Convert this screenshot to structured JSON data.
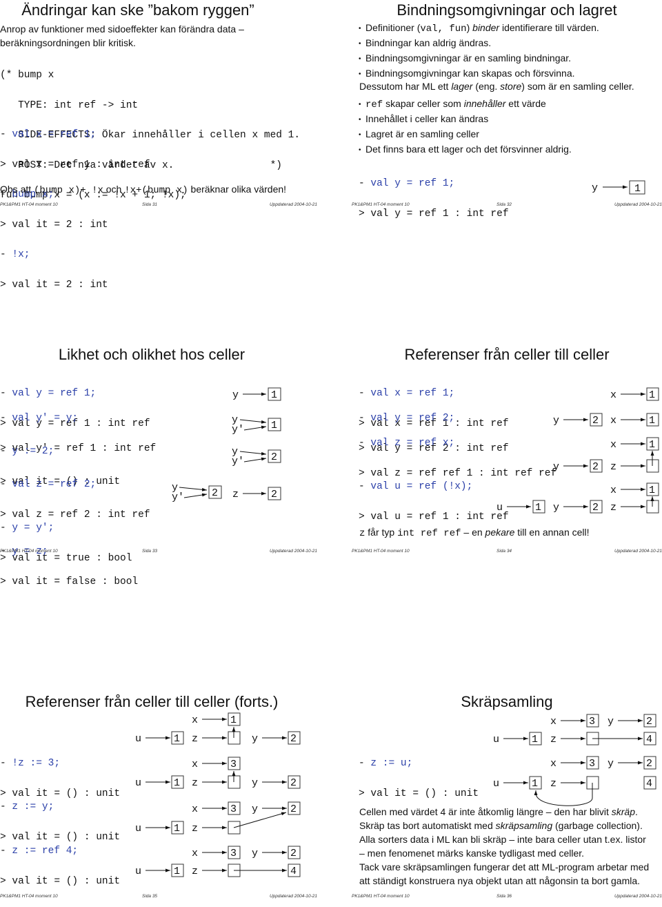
{
  "footer": {
    "course": "PK1&PM1 HT-04 moment 10",
    "updated": "Uppdaterad 2004-10-21"
  },
  "slides": [
    {
      "page": "Sida 31",
      "title": "Ändringar kan ske ”bakom ryggen”",
      "intro_line1": "Anrop av funktioner med sidoeffekter kan förändra data –",
      "intro_line2": "beräkningsordningen blir kritisk.",
      "comment_lines": [
        "(* bump x",
        "   TYPE: int ref -> int",
        "   SIDE-EFFECTS: Ökar innehåller i cellen x med 1.",
        "   POST: Det nya värdet av x.                *)",
        "fun bump x = (x := !x + 1; !x);"
      ],
      "session": [
        {
          "prompt": "- ",
          "input": "val x = ref 1;"
        },
        {
          "prompt": "> ",
          "output": "val x = ref 1 : int ref"
        },
        {
          "prompt": "- ",
          "input": "bump x;"
        },
        {
          "prompt": "> ",
          "output": "val it = 2 : int"
        },
        {
          "prompt": "- ",
          "input": "!x;"
        },
        {
          "prompt": "> ",
          "output": "val it = 2 : int"
        }
      ],
      "note": {
        "t1": "Obs att ",
        "c1": "(bump x)+ !x",
        "t2": " och ",
        "c2": "!x+(bump x)",
        "t3": " beräknar olika värden!"
      }
    },
    {
      "page": "Sida 32",
      "title": "Bindningsomgivningar och lagret",
      "bullets1": [
        {
          "a": "Definitioner (",
          "code": "val, fun",
          "b": ") ",
          "em": "binder",
          "c": " identifierare till värden."
        },
        {
          "a": "Bindningar kan aldrig ändras."
        },
        {
          "a": "Bindningsomgivningar är en samling bindningar."
        },
        {
          "a": "Bindningsomgivningar kan skapas och försvinna."
        }
      ],
      "store_line": {
        "a": "Dessutom har ML ett ",
        "em1": "lager",
        "b": " (eng. ",
        "em2": "store",
        "c": ") som är en samling celler."
      },
      "bullets2": [
        {
          "code": "ref",
          "a": " skapar celler som ",
          "em": "innehåller",
          "b": " ett värde"
        },
        {
          "a": "Innehållet i celler kan ändras"
        },
        {
          "a": "Lagret är en samling celler"
        },
        {
          "a": "Det finns bara ett lager och det försvinner aldrig."
        }
      ],
      "session": [
        {
          "prompt": "- ",
          "input": "val y = ref 1;"
        },
        {
          "prompt": "> ",
          "output": "val y = ref 1 : int ref"
        }
      ],
      "diagram": {
        "var": "y",
        "cell": "1"
      }
    },
    {
      "page": "Sida 33",
      "title": "Likhet och olikhet hos celler",
      "session_groups": [
        [
          {
            "prompt": "- ",
            "input": "val y = ref 1;"
          },
          {
            "prompt": "> ",
            "output": "val y = ref 1 : int ref"
          }
        ],
        [
          {
            "prompt": "- ",
            "input": "val y' = y;"
          },
          {
            "prompt": "> ",
            "output": "val y' = ref 1 : int ref"
          }
        ],
        [
          {
            "prompt": "- ",
            "input": "y := 2;"
          },
          {
            "prompt": "> ",
            "output": "val it = () : unit"
          }
        ],
        [
          {
            "prompt": "- ",
            "input": "val z = ref 2;"
          },
          {
            "prompt": "> ",
            "output": "val z = ref 2 : int ref"
          }
        ],
        [
          {
            "prompt": "- ",
            "input": "y = y';"
          },
          {
            "prompt": "> ",
            "output": "val it = true : bool"
          }
        ],
        [
          {
            "prompt": "- ",
            "input": "y = z;"
          },
          {
            "prompt": "> ",
            "output": "val it = false : bool"
          }
        ]
      ],
      "diagrams": [
        {
          "vars": [
            "y"
          ],
          "cell": "1"
        },
        {
          "vars": [
            "y",
            "y'"
          ],
          "cell": "1"
        },
        {
          "vars": [
            "y",
            "y'"
          ],
          "cell": "2"
        },
        {
          "vars": [
            "y",
            "y'"
          ],
          "cell": "2",
          "z_var": "z",
          "z_cell": "2"
        }
      ]
    },
    {
      "page": "Sida 34",
      "title": "Referenser från celler till celler",
      "session_groups": [
        [
          {
            "prompt": "- ",
            "input": "val x = ref 1;"
          },
          {
            "prompt": "> ",
            "output": "val x = ref 1 : int ref"
          }
        ],
        [
          {
            "prompt": "- ",
            "input": "val y = ref 2;"
          },
          {
            "prompt": "> ",
            "output": "val y = ref 2 : int ref"
          }
        ],
        [
          {
            "prompt": "- ",
            "input": "val z = ref x;"
          },
          {
            "prompt": "> ",
            "output": "val z = ref ref 1 : int ref ref"
          }
        ],
        [
          {
            "prompt": "- ",
            "input": "val u = ref (!x);"
          },
          {
            "prompt": "> ",
            "output": "val u = ref 1 : int ref"
          }
        ]
      ],
      "vars": {
        "x": "x",
        "y": "y",
        "z": "z",
        "u": "u"
      },
      "cells": {
        "x": "1",
        "y": "2",
        "u": "1"
      },
      "note": {
        "c1": "z",
        "t1": " får typ ",
        "c2": "int ref ref",
        "t2": " – en ",
        "em": "pekare",
        "t3": " till en annan cell!"
      }
    },
    {
      "page": "Sida 35",
      "title": "Referenser från celler till celler (forts.)",
      "session_groups": [
        [
          {
            "prompt": "- ",
            "input": "!z := 3;"
          },
          {
            "prompt": "> ",
            "output": "val it = () : unit"
          }
        ],
        [
          {
            "prompt": "- ",
            "input": "z := y;"
          },
          {
            "prompt": "> ",
            "output": "val it = () : unit"
          }
        ],
        [
          {
            "prompt": "- ",
            "input": "z := ref 4;"
          },
          {
            "prompt": "> ",
            "output": "val it = () : unit"
          }
        ]
      ],
      "states": [
        {
          "x": "1",
          "u": "1",
          "y": "2"
        },
        {
          "x": "3",
          "u": "1",
          "y": "2"
        },
        {
          "x": "3",
          "u": "1",
          "y": "2"
        },
        {
          "x": "3",
          "u": "1",
          "y": "2",
          "new": "4"
        }
      ],
      "vars": {
        "x": "x",
        "y": "y",
        "z": "z",
        "u": "u"
      }
    },
    {
      "page": "Sida 36",
      "title": "Skräpsamling",
      "session": [
        {
          "prompt": "- ",
          "input": "z := u;"
        },
        {
          "prompt": "> ",
          "output": "val it = () : unit"
        }
      ],
      "states": [
        {
          "x": "3",
          "u": "1",
          "y": "2",
          "w": "4"
        },
        {
          "x": "3",
          "u": "1",
          "y": "2",
          "w": "4"
        }
      ],
      "vars": {
        "x": "x",
        "y": "y",
        "z": "z",
        "u": "u"
      },
      "paragraphs": [
        {
          "a": "Cellen med värdet 4 är inte åtkomlig längre – den har blivit ",
          "em": "skräp",
          "b": "."
        },
        {
          "a": "Skräp tas bort automatiskt med ",
          "em": "skräpsamling",
          "b": " (garbage collection)."
        },
        {
          "a": "Alla sorters data i ML kan bli skräp – inte bara celler utan t.ex. listor"
        },
        {
          "a": "– men fenomenet märks kanske tydligast med celler."
        },
        {
          "a": "Tack vare skräpsamlingen fungerar det att ML-program arbetar med"
        },
        {
          "a": "att ständigt konstruera nya objekt utan att någonsin ta bort gamla."
        }
      ]
    }
  ]
}
